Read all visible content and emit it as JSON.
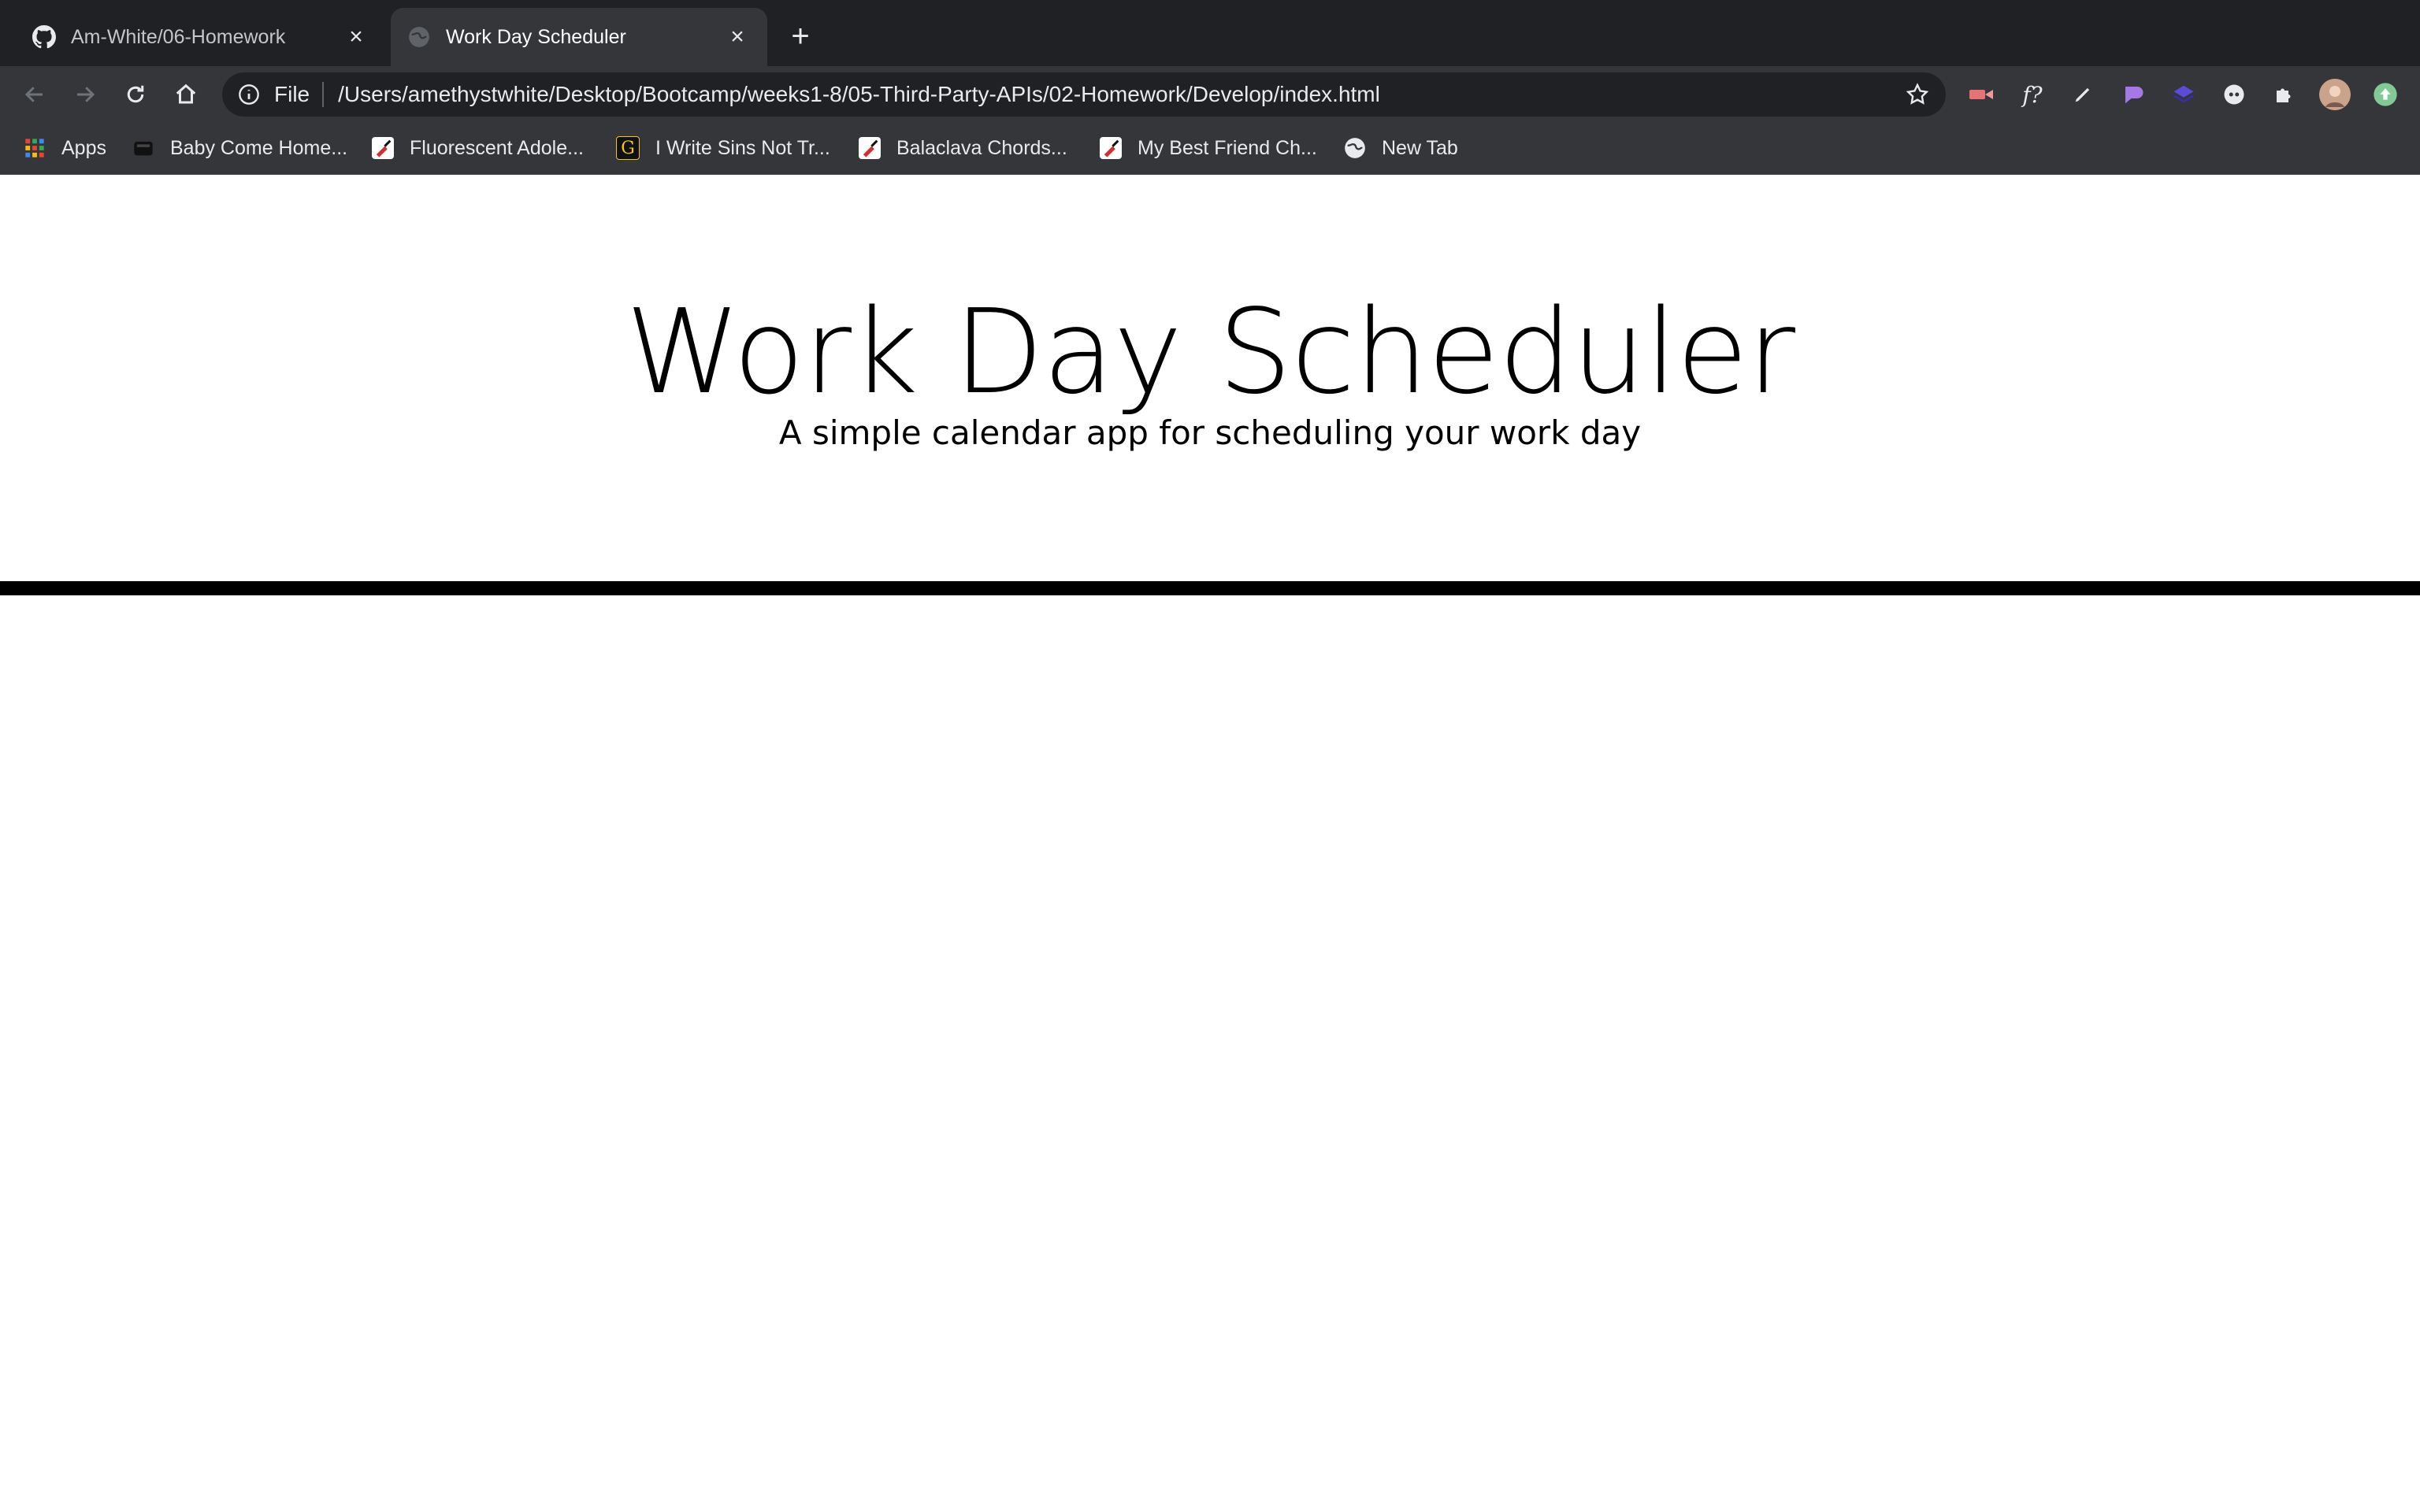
{
  "browser": {
    "tabs": [
      {
        "title": "Am-White/06-Homework",
        "favicon": "github-icon",
        "active": false
      },
      {
        "title": "Work Day Scheduler",
        "favicon": "globe-icon",
        "active": true
      }
    ],
    "address": {
      "scheme": "File",
      "url": "/Users/amethystwhite/Desktop/Bootcamp/weeks1-8/05-Third-Party-APIs/02-Homework/Develop/index.html"
    },
    "extensions": [
      "video-extension-icon",
      "formula-extension-icon",
      "pen-extension-icon",
      "purple-shape-extension-icon",
      "layers-extension-icon",
      "circle-extension-icon",
      "puzzle-icon",
      "avatar",
      "update-icon"
    ],
    "formula_ext_label": "f?",
    "bookmarks": [
      {
        "label": "Apps",
        "icon": "apps-grid-icon"
      },
      {
        "label": "Baby Come Home...",
        "icon": "bookmark-favicon"
      },
      {
        "label": "Fluorescent Adole...",
        "icon": "guitar-favicon"
      },
      {
        "label": "I Write Sins Not Tr...",
        "icon": "g-favicon"
      },
      {
        "label": "Balaclava Chords...",
        "icon": "guitar-favicon"
      },
      {
        "label": "My Best Friend Ch...",
        "icon": "guitar-favicon"
      },
      {
        "label": "New Tab",
        "icon": "globe-icon"
      }
    ]
  },
  "page": {
    "title": "Work Day Scheduler",
    "lead": "A simple calendar app for scheduling your work day"
  },
  "colors": {
    "chrome_dark": "#202124",
    "chrome_mid": "#35363a",
    "page_bg": "#ffffff",
    "divider": "#000000"
  }
}
